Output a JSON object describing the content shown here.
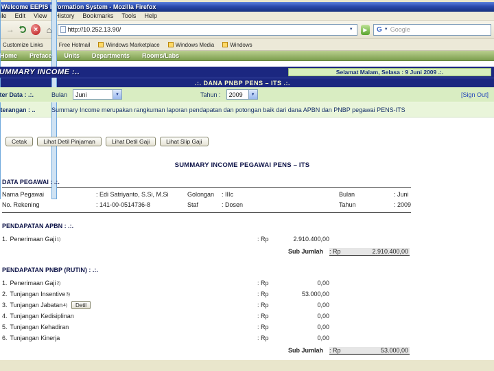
{
  "theme": {
    "navy": "#1b2780",
    "nav_green": "#7c9e4e",
    "filter_green": "#d9edc2",
    "keterangan_green": "#e9f5da",
    "greeting_green": "#d7eebd",
    "slide_background": "#e9e6cc",
    "sign_out_blue": "#2244bb"
  },
  "icons": {
    "back": "←",
    "forward": "→",
    "stop": "×",
    "home": "⌂",
    "go": "▶",
    "dropdown_arrow": "▼",
    "select_arrow": "▼",
    "search_engine_initial": "G"
  },
  "browser": {
    "title": "Welcome EEPIS Information System - Mozilla Firefox",
    "menus": [
      "File",
      "Edit",
      "View",
      "History",
      "Bookmarks",
      "Tools",
      "Help"
    ],
    "url": "http://10.252.13.90/",
    "search_placeholder": "Google",
    "bookmarks": [
      "Customize Links",
      "Free Hotmail",
      "Windows Marketplace",
      "Windows Media",
      "Windows"
    ]
  },
  "site_nav": {
    "items": [
      "Home",
      "Preface",
      "Units",
      "Departments",
      "Rooms/Labs"
    ]
  },
  "header": {
    "title": "SUMMARY INCOME :..",
    "greeting": "Selamat Malam, Selasa : 9 Juni 2009 .:.",
    "banner": ".:. DANA PNBP PENS – ITS .:."
  },
  "filter": {
    "label": "Filter Data : .:.",
    "bulan_label": "Bulan",
    "bulan_value": "Juni",
    "tahun_label": "Tahun :",
    "tahun_value": "2009",
    "sign_out": "[Sign Out]"
  },
  "keterangan": {
    "label": "Keterangan : ..",
    "text": "Summary Income merupakan rangkuman laporan pendapatan dan potongan baik dari dana APBN dan PNBP pegawai PENS-ITS"
  },
  "actions": {
    "buttons": [
      "Cetak",
      "Lihat Detil Pinjaman",
      "Lihat Detil Gaji",
      "Lihat Slip Gaji"
    ]
  },
  "report": {
    "title": "SUMMARY INCOME PEGAWAI PENS – ITS",
    "rp": ": Rp",
    "data_pegawai": {
      "heading": "DATA PEGAWAI : .:.",
      "fields": [
        {
          "label": "Nama Pegawai",
          "value": ": Edi Satriyanto, S.Si, M.Si"
        },
        {
          "label": "No. Rekening",
          "value": ": 141-00-0514736-8"
        },
        {
          "label": "Golongan",
          "value": ": IIIc"
        },
        {
          "label": "Staf",
          "value": ": Dosen"
        },
        {
          "label": "Bulan",
          "value": ": Juni"
        },
        {
          "label": "Tahun",
          "value": ": 2009"
        }
      ]
    },
    "apbn": {
      "heading": "PENDAPATAN APBN : .:.",
      "items": [
        {
          "no": "1.",
          "label": "Penerimaan Gaji",
          "sup": "1)",
          "amount": "2.910.400,00"
        }
      ],
      "sub_label": "Sub Jumlah",
      "sub_amount": "2.910.400,00"
    },
    "pnbp": {
      "heading": "PENDAPATAN PNBP (RUTIN) : .:.",
      "items": [
        {
          "no": "1.",
          "label": "Penerimaan Gaji",
          "sup": "2)",
          "amount": "0,00"
        },
        {
          "no": "2.",
          "label": "Tunjangan Insentive",
          "sup": "3)",
          "amount": "53.000,00"
        },
        {
          "no": "3.",
          "label": "Tunjangan Jabatan",
          "sup": "4)",
          "button_label": "Detil",
          "amount": "0,00"
        },
        {
          "no": "4.",
          "label": "Tunjangan Kedisiplinan",
          "amount": "0,00"
        },
        {
          "no": "5.",
          "label": "Tunjangan Kehadiran",
          "amount": "0,00"
        },
        {
          "no": "6.",
          "label": "Tunjangan Kinerja",
          "amount": "0,00"
        }
      ],
      "sub_label": "Sub Jumlah",
      "sub_amount": "53.000,00"
    }
  }
}
